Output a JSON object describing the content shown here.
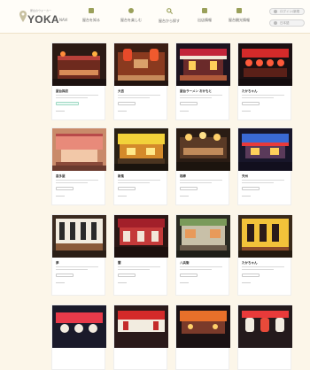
{
  "header": {
    "logo_tagline": "屋台のウォーカー",
    "logo_main": "YOKA",
    "logo_sub": "NAVI"
  },
  "nav": [
    {
      "label": "屋台を知る",
      "icon": "building-icon"
    },
    {
      "label": "屋台を楽しむ",
      "icon": "bowl-icon"
    },
    {
      "label": "屋台から探す",
      "icon": "search-icon"
    },
    {
      "label": "出店情報",
      "icon": "clipboard-icon"
    },
    {
      "label": "屋台観光情報",
      "icon": "landmark-icon"
    }
  ],
  "header_buttons": [
    {
      "label": "ログイン/新規"
    },
    {
      "label": "日本語"
    }
  ],
  "colors": {
    "accent": "#9aa05a",
    "background": "#fcf6e9",
    "highlight": "#9ed8c3"
  },
  "cards": [
    {
      "name": "屋台探訪",
      "photo": "stall-night-red"
    },
    {
      "name": "大吉",
      "photo": "stall-red-lanterns"
    },
    {
      "name": "屋台ラーメン おかもと",
      "photo": "stall-red-awning"
    },
    {
      "name": "たかちゃん",
      "photo": "stall-red-lantern-row"
    },
    {
      "name": "喜多屋",
      "photo": "stall-pink-curtain"
    },
    {
      "name": "新風",
      "photo": "stall-yellow-interior"
    },
    {
      "name": "相棒",
      "photo": "stall-warm-lights"
    },
    {
      "name": "天州",
      "photo": "stall-blue-awning"
    },
    {
      "name": "夢",
      "photo": "stall-white-noren"
    },
    {
      "name": "蘭",
      "photo": "stall-red-sign"
    },
    {
      "name": "八兵衛",
      "photo": "stall-green-roof"
    },
    {
      "name": "たかちゃん",
      "photo": "stall-yellow-lantern"
    },
    {
      "name": "",
      "photo": "stall-white-lanterns"
    },
    {
      "name": "",
      "photo": "stall-red-white"
    },
    {
      "name": "",
      "photo": "stall-orange-night"
    },
    {
      "name": "",
      "photo": "stall-lanterns-red-white"
    }
  ]
}
